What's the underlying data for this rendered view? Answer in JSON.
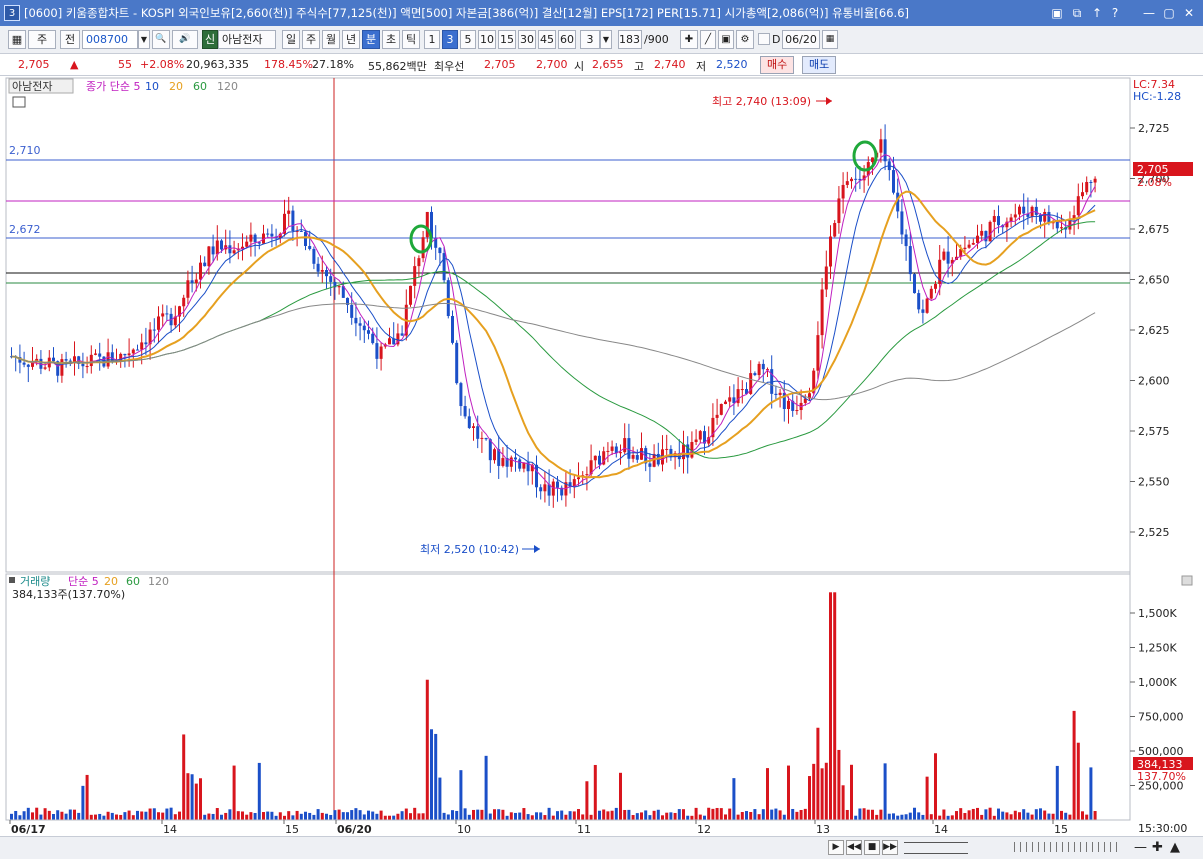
{
  "window": {
    "app_icon": "3",
    "title": "[0600] 키움종합차트 - KOSPI 외국인보유[2,660(천)] 주식수[77,125(천)] 액면[500] 자본금[386(억)] 결산[12월] EPS[172] PER[15.71] 시가총액[2,086(억)] 유통비율[66.6]",
    "controls": [
      "▣",
      "⧉",
      "↑",
      "?",
      "—",
      "▢",
      "✕"
    ]
  },
  "toolbar": {
    "market": "주",
    "all": "전",
    "code": "008700",
    "search_icon": "🔍",
    "speaker_icon": "🔊",
    "credit_badge": "신",
    "stock_name": "아남전자",
    "periods": [
      "일",
      "주",
      "월",
      "년",
      "분",
      "초",
      "틱"
    ],
    "selected_period": "분",
    "intervals": [
      "1",
      "3",
      "5",
      "10",
      "15",
      "30",
      "45",
      "60"
    ],
    "selected_interval": "3",
    "interval_value": "3",
    "count": "183",
    "count_total": "/900",
    "checkbox_label": "D",
    "date": "06/20"
  },
  "quote": {
    "price": "2,705",
    "change_arrow": "▲",
    "change": "55",
    "change_pct": "+2.08%",
    "volume": "20,963,335",
    "volume_ratio": "178.45%",
    "turnover": "27.18%",
    "value": "55,862백만",
    "pref_label": "최우선",
    "ask": "2,705",
    "bid": "2,700",
    "open_label": "시",
    "open": "2,655",
    "high_label": "고",
    "high": "2,740",
    "low_label": "저",
    "low": "2,520",
    "buy_label": "매수",
    "sell_label": "매도"
  },
  "price_panel": {
    "stock_label": "아남전자",
    "ma_legend": [
      {
        "label": "종가 단순 5",
        "color": "#c020c0"
      },
      {
        "label": "10",
        "color": "#1b4fc8"
      },
      {
        "label": "20",
        "color": "#e6a020"
      },
      {
        "label": "60",
        "color": "#2a9a40"
      },
      {
        "label": "120",
        "color": "#888888"
      }
    ],
    "lc_label": "LC:7.34",
    "hc_label": "HC:-1.28",
    "high_marker": "최고 2,740 (13:09)",
    "low_marker": "최저 2,520 (10:42)",
    "line_2710": "2,710",
    "line_2672": "2,672",
    "last_price_tag": "2,705",
    "last_pct_tag": "2.08%",
    "axis_ticks": [
      "2,725",
      "2,700",
      "2,675",
      "2,650",
      "2,625",
      "2,600",
      "2,575",
      "2,550",
      "2,525"
    ]
  },
  "volume_panel": {
    "legend_title": "거래량",
    "ma_legend": [
      {
        "label": "단순 5",
        "color": "#c020c0"
      },
      {
        "label": "20",
        "color": "#e6a020"
      },
      {
        "label": "60",
        "color": "#2a9a40"
      },
      {
        "label": "120",
        "color": "#888888"
      }
    ],
    "current": "384,133주(137.70%)",
    "axis_ticks": [
      "1,500K",
      "1,250K",
      "1,000K",
      "750,000",
      "500,000",
      "250,000"
    ],
    "last_volume_tag": "384,133",
    "last_pct_tag": "137.70%"
  },
  "time_axis": {
    "labels": [
      "06/17",
      "14",
      "15",
      "06/20",
      "10",
      "11",
      "12",
      "13",
      "14",
      "15"
    ],
    "end_time": "15:30:00"
  },
  "colors": {
    "up": "#d8151d",
    "down": "#1b4fc8",
    "ma5": "#c020c0",
    "ma10": "#1b4fc8",
    "ma20": "#e6a020",
    "ma60": "#2a9a40",
    "ma120": "#888888"
  },
  "chart_data": {
    "type": "candlestick",
    "price_range": [
      2510,
      2750
    ],
    "volume_range": [
      0,
      1750000
    ],
    "price_lines": [
      {
        "value": 2710,
        "label": "2,710"
      },
      {
        "value": 2672,
        "label": "2,672"
      }
    ],
    "high": {
      "value": 2740,
      "time": "13:09"
    },
    "low": {
      "value": 2520,
      "time": "10:42"
    },
    "last_price": 2705,
    "last_volume": 384133
  }
}
